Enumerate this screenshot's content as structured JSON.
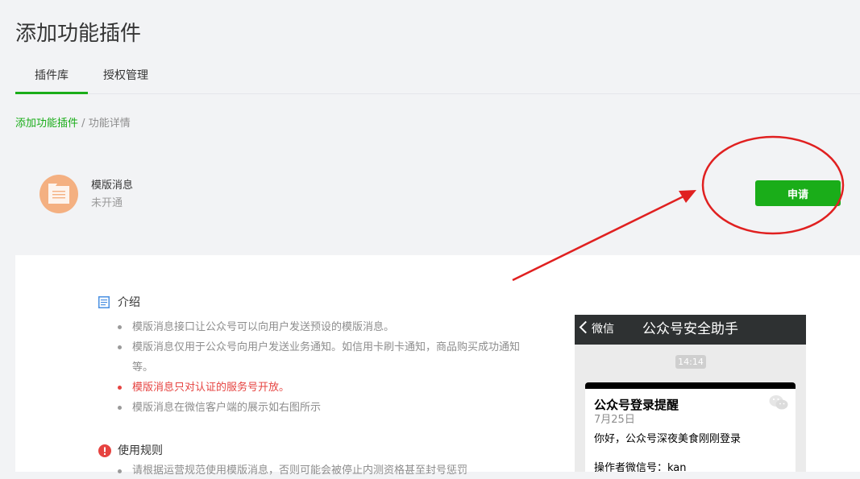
{
  "header": {
    "title": "添加功能插件",
    "tabs": [
      {
        "label": "插件库",
        "active": true
      },
      {
        "label": "授权管理",
        "active": false
      }
    ]
  },
  "breadcrumb": {
    "root": "添加功能插件",
    "separator": "/",
    "current": "功能详情"
  },
  "plugin": {
    "name": "模版消息",
    "status": "未开通",
    "icon": "document-icon",
    "apply_label": "申请"
  },
  "intro": {
    "heading": "介绍",
    "icon": "document-list-icon",
    "bullets": [
      {
        "text": "模版消息接口让公众号可以向用户发送预设的模版消息。",
        "warn": false
      },
      {
        "text": "模版消息仅用于公众号向用户发送业务通知。如信用卡刷卡通知，商品购买成功通知等。",
        "warn": false
      },
      {
        "text": "模版消息只对认证的服务号开放。",
        "warn": true
      },
      {
        "text": "模版消息在微信客户端的展示如右图所示",
        "warn": false
      }
    ]
  },
  "rules": {
    "heading": "使用规则",
    "icon": "exclamation-icon",
    "bullet": "请根据运营规范使用模版消息，否则可能会被停止内测资格甚至封号惩罚"
  },
  "phone_preview": {
    "back_label": "微信",
    "title": "公众号安全助手",
    "time": "14:14",
    "card": {
      "title": "公众号登录提醒",
      "date": "7月25日",
      "body": "你好，公众号深夜美食刚刚登录",
      "operator": "操作者微信号：kan"
    }
  },
  "colors": {
    "accent": "#1aad19",
    "warning": "#e64340",
    "annotation": "#e02020"
  }
}
